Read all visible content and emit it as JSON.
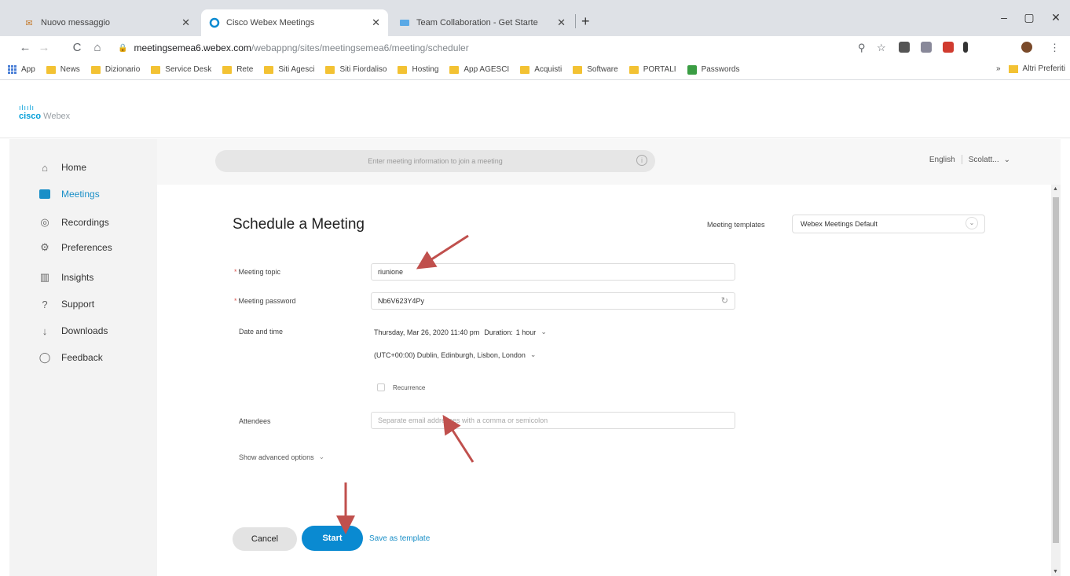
{
  "browser": {
    "tabs": [
      {
        "title": "Nuovo messaggio",
        "icon": "mail-icon"
      },
      {
        "title": "Cisco Webex Meetings",
        "icon": "webex-icon"
      },
      {
        "title": "Team Collaboration - Get Starte",
        "icon": "teams-icon"
      }
    ],
    "new_tab": "+",
    "window": {
      "minimize": "–",
      "maximize": "▢",
      "close": "✕"
    },
    "nav": {
      "back": "←",
      "forward": "→",
      "reload": "C",
      "home": "⌂"
    },
    "url_host": "meetingsemea6.webex.com",
    "url_path": "/webappng/sites/meetingsemea6/meeting/scheduler",
    "bookmarks": [
      "App",
      "News",
      "Dizionario",
      "Service Desk",
      "Rete",
      "Siti Agesci",
      "Siti Fiordaliso",
      "Hosting",
      "App AGESCI",
      "Acquisti",
      "Software",
      "PORTALI",
      "Passwords"
    ],
    "bookmarks_overflow": "»",
    "other_bookmarks": "Altri Preferiti"
  },
  "brand": {
    "cisco": "cisco",
    "product": "Webex"
  },
  "sidebar": {
    "items": [
      {
        "label": "Home",
        "icon": "home-icon",
        "glyph": "⌂"
      },
      {
        "label": "Meetings",
        "icon": "meetings-icon",
        "glyph": ""
      },
      {
        "label": "Recordings",
        "icon": "recordings-icon",
        "glyph": "◎"
      },
      {
        "label": "Preferences",
        "icon": "gear-icon",
        "glyph": "⚙"
      },
      {
        "label": "Insights",
        "icon": "insights-icon",
        "glyph": "▥"
      },
      {
        "label": "Support",
        "icon": "support-icon",
        "glyph": "?"
      },
      {
        "label": "Downloads",
        "icon": "download-icon",
        "glyph": "↓"
      },
      {
        "label": "Feedback",
        "icon": "feedback-icon",
        "glyph": "◯"
      }
    ]
  },
  "header": {
    "join_placeholder": "Enter meeting information to join a meeting",
    "language": "English",
    "user": "Scolatt..."
  },
  "form": {
    "title": "Schedule a Meeting",
    "templates_label": "Meeting templates",
    "templates_value": "Webex Meetings Default",
    "topic_label": "Meeting topic",
    "topic_value": "riunione",
    "password_label": "Meeting password",
    "password_value": "Nb6V623Y4Py",
    "datetime_label": "Date and time",
    "datetime_value": "Thursday, Mar 26, 2020 11:40 pm",
    "duration_label": "Duration:",
    "duration_value": "1 hour",
    "timezone_value": "(UTC+00:00) Dublin, Edinburgh, Lisbon, London",
    "recurrence_label": "Recurrence",
    "attendees_label": "Attendees",
    "attendees_placeholder": "Separate email addresses with a comma or semicolon",
    "advanced_label": "Show advanced options",
    "cancel_label": "Cancel",
    "start_label": "Start",
    "save_template_label": "Save as template"
  },
  "colors": {
    "accent": "#0a8ad1",
    "annotation_arrow": "#c0504d"
  }
}
